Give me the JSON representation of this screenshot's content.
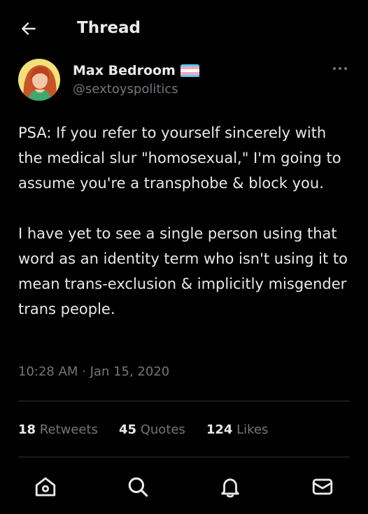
{
  "header": {
    "title": "Thread",
    "back_icon": "arrow-left-icon"
  },
  "author": {
    "display_name": "Max Bedroom",
    "handle": "@sextoyspolitics",
    "badge_icon": "trans-flag-icon",
    "flag_colors": [
      "#5BCEFA",
      "#F5A9B8",
      "#FFFFFF",
      "#F5A9B8",
      "#5BCEFA"
    ],
    "more_icon": "more-options-icon"
  },
  "tweet": {
    "text": "PSA: If you refer to yourself sincerely with the medical slur \"homosexual,\" I'm going to assume you're a transphobe & block you.\n\nI have yet to see a single person using that word as an identity term who isn't using it to mean trans-exclusion & implicitly misgender trans people.",
    "timestamp": "10:28 AM · Jan 15, 2020"
  },
  "stats": {
    "retweets_count": "18",
    "retweets_label": "Retweets",
    "quotes_count": "45",
    "quotes_label": "Quotes",
    "likes_count": "124",
    "likes_label": "Likes"
  },
  "nav": {
    "home_icon": "home-icon",
    "search_icon": "search-icon",
    "notifications_icon": "bell-icon",
    "messages_icon": "mail-icon"
  },
  "colors": {
    "background": "#000000",
    "text": "#e7e9ea",
    "secondary_text": "#71767b",
    "divider": "#2f3336"
  }
}
